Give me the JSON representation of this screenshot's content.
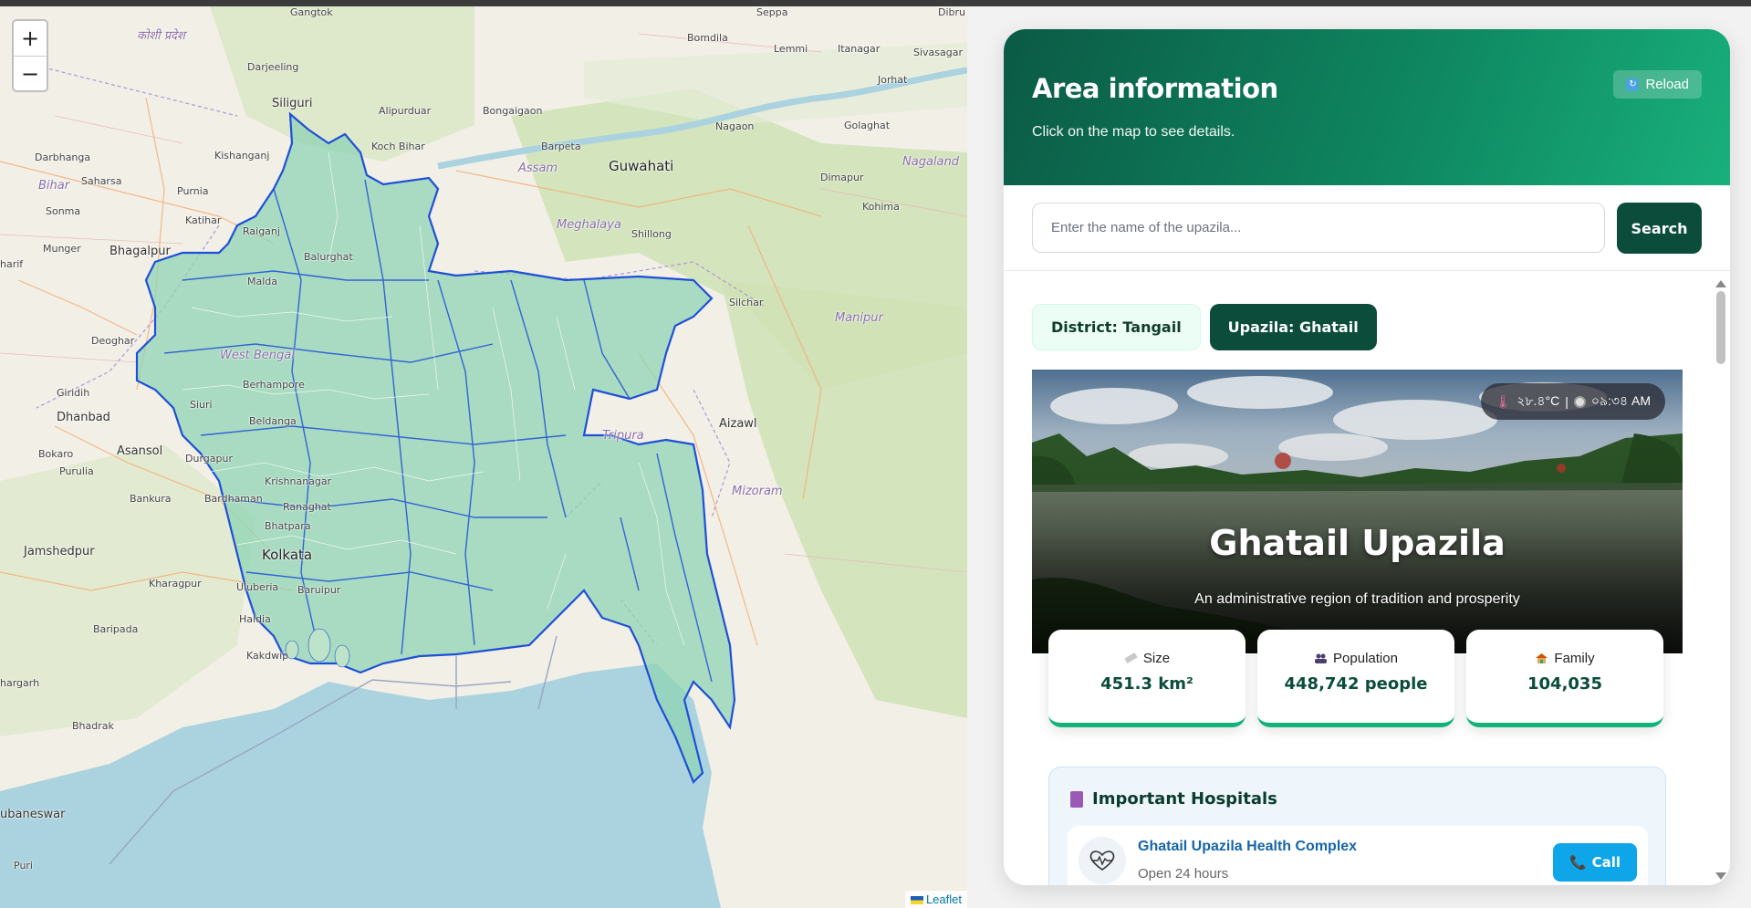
{
  "map": {
    "zoom_in": "+",
    "zoom_out": "−",
    "attribution": "Leaflet",
    "labels": [
      {
        "text": "Gangtok",
        "cls": "small"
      },
      {
        "text": "Seppa",
        "cls": "small"
      },
      {
        "text": "Dibru",
        "cls": "small"
      },
      {
        "text": "कोशी प्रदेश",
        "cls": "region"
      },
      {
        "text": "Bomdila",
        "cls": "small"
      },
      {
        "text": "Lemmi",
        "cls": "small"
      },
      {
        "text": "Itanagar",
        "cls": "small"
      },
      {
        "text": "Sivasagar",
        "cls": "small"
      },
      {
        "text": "Darjeeling",
        "cls": "small"
      },
      {
        "text": "Jorhat",
        "cls": "small"
      },
      {
        "text": "Siliguri",
        "cls": "city"
      },
      {
        "text": "Alipurduar",
        "cls": "small"
      },
      {
        "text": "Bongaigaon",
        "cls": "small"
      },
      {
        "text": "Nagaon",
        "cls": "small"
      },
      {
        "text": "Golaghat",
        "cls": "small"
      },
      {
        "text": "Koch Bihar",
        "cls": "small"
      },
      {
        "text": "Barpeta",
        "cls": "small"
      },
      {
        "text": "Darbhanga",
        "cls": "small"
      },
      {
        "text": "Kishanganj",
        "cls": "small"
      },
      {
        "text": "Assam",
        "cls": "region"
      },
      {
        "text": "Guwahati",
        "cls": "big"
      },
      {
        "text": "Nagaland",
        "cls": "region"
      },
      {
        "text": "Saharsa",
        "cls": "small"
      },
      {
        "text": "Bihar",
        "cls": "region"
      },
      {
        "text": "Purnia",
        "cls": "small"
      },
      {
        "text": "Dimapur",
        "cls": "small"
      },
      {
        "text": "Sonma",
        "cls": "small"
      },
      {
        "text": "Katihar",
        "cls": "small"
      },
      {
        "text": "Raiganj",
        "cls": "small"
      },
      {
        "text": "Kohima",
        "cls": "small"
      },
      {
        "text": "Meghalaya",
        "cls": "region"
      },
      {
        "text": "Munger",
        "cls": "small"
      },
      {
        "text": "Bhagalpur",
        "cls": "city"
      },
      {
        "text": "Shillong",
        "cls": "small"
      },
      {
        "text": "Balurghat",
        "cls": "small"
      },
      {
        "text": "Malda",
        "cls": "small"
      },
      {
        "text": "Silchar",
        "cls": "small"
      },
      {
        "text": "Manipur",
        "cls": "region"
      },
      {
        "text": "Deoghar",
        "cls": "small"
      },
      {
        "text": "West Bengal",
        "cls": "region"
      },
      {
        "text": "Berhampore",
        "cls": "small"
      },
      {
        "text": "Giridih",
        "cls": "small"
      },
      {
        "text": "Siuri",
        "cls": "small"
      },
      {
        "text": "Aizawl",
        "cls": "city"
      },
      {
        "text": "Dhanbad",
        "cls": "city"
      },
      {
        "text": "Beldanga",
        "cls": "small"
      },
      {
        "text": "Tripura",
        "cls": "region"
      },
      {
        "text": "Bokaro",
        "cls": "small"
      },
      {
        "text": "Asansol",
        "cls": "city"
      },
      {
        "text": "Durgapur",
        "cls": "small"
      },
      {
        "text": "Purulia",
        "cls": "small"
      },
      {
        "text": "Krishnanagar",
        "cls": "small"
      },
      {
        "text": "Mizoram",
        "cls": "region"
      },
      {
        "text": "Bankura",
        "cls": "small"
      },
      {
        "text": "Bardhaman",
        "cls": "small"
      },
      {
        "text": "Ranaghat",
        "cls": "small"
      },
      {
        "text": "Bhatpara",
        "cls": "small"
      },
      {
        "text": "Jamshedpur",
        "cls": "city"
      },
      {
        "text": "Kolkata",
        "cls": "big"
      },
      {
        "text": "Kharagpur",
        "cls": "small"
      },
      {
        "text": "Uluberia",
        "cls": "small"
      },
      {
        "text": "Baruipur",
        "cls": "small"
      },
      {
        "text": "Haldia",
        "cls": "small"
      },
      {
        "text": "Baripada",
        "cls": "small"
      },
      {
        "text": "Kakdwip",
        "cls": "small"
      },
      {
        "text": "hargarh",
        "cls": "small"
      },
      {
        "text": "Bhadrak",
        "cls": "small"
      },
      {
        "text": "ubaneswar",
        "cls": "city"
      },
      {
        "text": "Puri",
        "cls": "small"
      },
      {
        "text": "harif",
        "cls": "small"
      }
    ]
  },
  "panel": {
    "title": "Area information",
    "subtitle": "Click on the map to see details.",
    "reload_label": "Reload",
    "search_placeholder": "Enter the name of the upazila...",
    "search_label": "Search",
    "chip_district": "District: Tangail",
    "chip_upazila": "Upazila: Ghatail",
    "hero": {
      "temperature": "২৮.৪°C",
      "separator": "|",
      "time": "০৯:৩৪ AM",
      "title": "Ghatail Upazila",
      "subtitle": "An administrative region of tradition and prosperity"
    },
    "stats": [
      {
        "label": "Size",
        "value": "451.3 km²",
        "icon": "ruler-icon"
      },
      {
        "label": "Population",
        "value": "448,742 people",
        "icon": "people-icon"
      },
      {
        "label": "Family",
        "value": "104,035",
        "icon": "house-icon"
      }
    ],
    "hospitals": {
      "title": "Important Hospitals",
      "items": [
        {
          "name": "Ghatail Upazila Health Complex",
          "hours": "Open 24 hours",
          "call_label": "Call"
        }
      ]
    }
  },
  "colors": {
    "region_fill": "#8fd4b4",
    "region_stroke": "#1e4fd8",
    "accent_dark": "#0b4d3a",
    "accent_green": "#12b37a",
    "call_blue": "#0ea5e9"
  }
}
